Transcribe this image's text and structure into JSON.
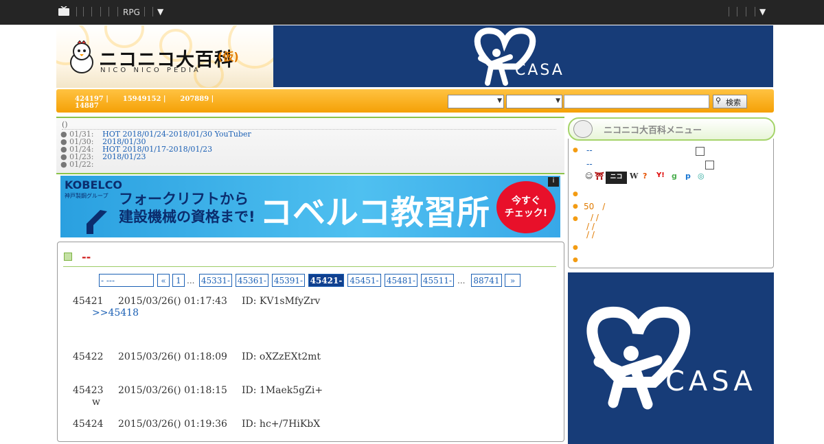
{
  "topbar": {
    "rpg_label": "RPG",
    "menu_arrow": "▼",
    "right_arrow": "▼"
  },
  "header": {
    "logo_text": "ニコニコ大百科",
    "logo_paren": "(仮)",
    "logo_sub": "NICO NICO PEDIA"
  },
  "banner_top": {
    "brand": "CASA"
  },
  "navbar": {
    "stats_line1": "424197 |      15949152 |      207889 |",
    "stats_line2": "14887",
    "search_button": "検索"
  },
  "news": {
    "header": "()",
    "items": [
      {
        "date": "01/31:",
        "text": "HOT 2018/01/24-2018/01/30 YouTuber"
      },
      {
        "date": "01/30:",
        "text": "2018/01/30"
      },
      {
        "date": "01/24:",
        "text": "HOT 2018/01/17-2018/01/23"
      },
      {
        "date": "01/23:",
        "text": "2018/01/23"
      },
      {
        "date": "01/22:",
        "text": ""
      }
    ]
  },
  "ad_left": {
    "brand": "KOBELCO",
    "brand_sub": "神戸製鋼グループ",
    "line1": "フォークリフトから",
    "line2": "建設機械の資格まで!",
    "big": "コベルコ教習所",
    "cta_line1": "今すぐ",
    "cta_line2": "チェック!",
    "info": "i"
  },
  "main": {
    "title": "--",
    "pager": {
      "first": "- ---",
      "prev": "«",
      "pages": [
        "1",
        "45331-",
        "45361-",
        "45391-",
        "45421-",
        "45451-",
        "45481-",
        "45511-",
        "88741"
      ],
      "ellipsis": "...",
      "next": "»"
    },
    "responses": [
      {
        "num": "45421",
        "datetime": "2015/03/26() 01:17:43",
        "id": "ID: KV1sMfyZrv",
        "body": ">>45418"
      },
      {
        "num": "45422",
        "datetime": "2015/03/26() 01:18:09",
        "id": "ID: oXZzEXt2mt",
        "body": ""
      },
      {
        "num": "45423",
        "datetime": "2015/03/26() 01:18:15",
        "id": "ID: 1Maek5gZi+",
        "body": "w"
      },
      {
        "num": "45424",
        "datetime": "2015/03/26() 01:19:36",
        "id": "ID: hc+/7HiKbX",
        "body": ""
      }
    ]
  },
  "sidebar": {
    "menu_title": "ニコニコ大百科メニュー",
    "link1": "--",
    "link2": "--",
    "item_50": "50　/",
    "slashes1": "/ /",
    "slashes2": "/ /",
    "slashes3": "/ /",
    "ext_w": "W",
    "ext_y": "Y!",
    "ext_p": "p"
  },
  "ad_right": {
    "brand": "CASA"
  },
  "colors": {
    "topbar": "#252525",
    "nav_orange": "#f5a106",
    "casa_blue": "#173c78",
    "link_blue": "#1a5fb4",
    "accent_green": "#8bc34a"
  }
}
